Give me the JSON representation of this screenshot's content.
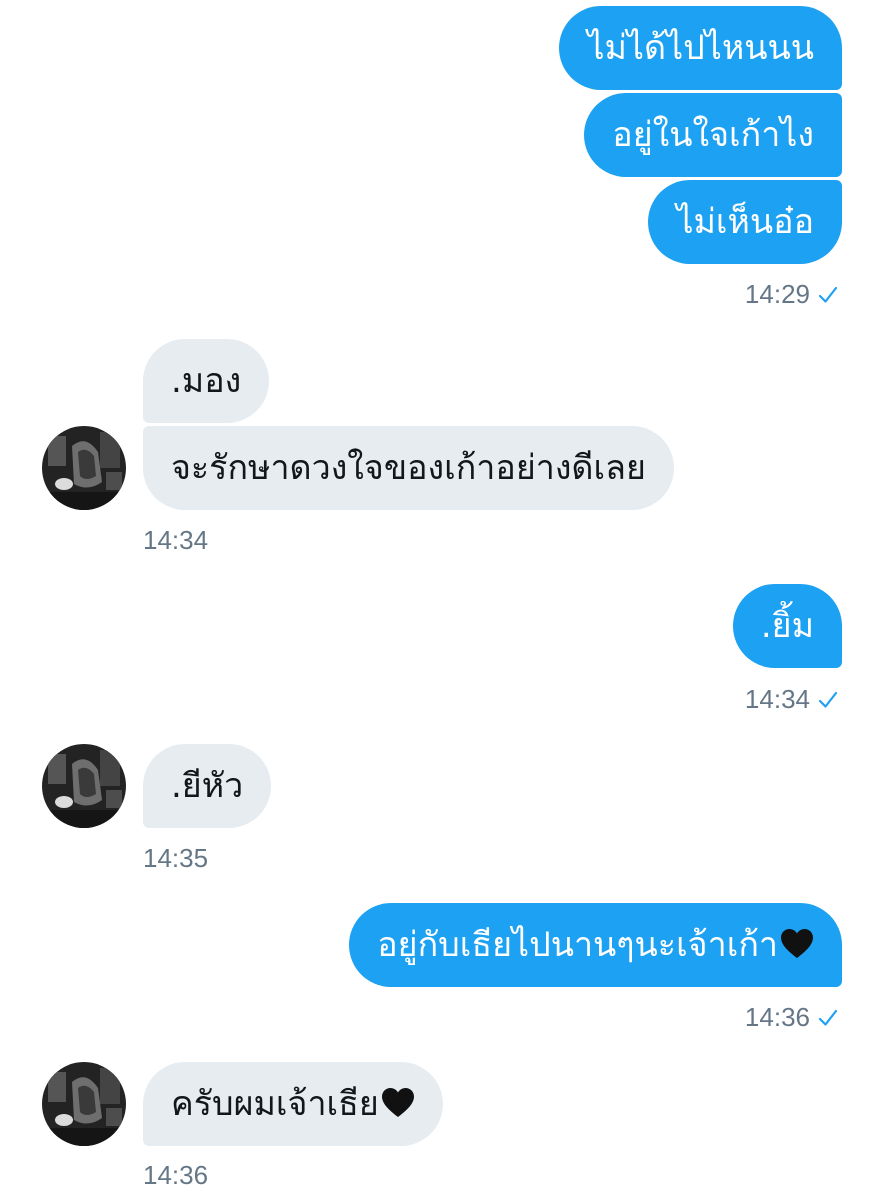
{
  "conversation": {
    "messages": [
      {
        "side": "out",
        "text": "ไม่ได้ไปไหนนน"
      },
      {
        "side": "out",
        "text": "อยู่ในใจเก้าไง"
      },
      {
        "side": "out",
        "text": "ไม่เห็นอ๋อ"
      },
      {
        "side": "in",
        "text": ".มอง"
      },
      {
        "side": "in",
        "text": "จะรักษาดวงใจของเก้าอย่างดีเลย"
      },
      {
        "side": "out",
        "text": ".ยิ้ม"
      },
      {
        "side": "in",
        "text": ".ยีหัว"
      },
      {
        "side": "out",
        "text": "อยู่กับเธียไปนานๆนะเจ้าเก้า",
        "emoji": "black-heart"
      },
      {
        "side": "in",
        "text": "ครับผมเจ้าเธีย",
        "emoji": "black-heart"
      }
    ],
    "timestamps": [
      "14:29",
      "14:34",
      "14:34",
      "14:35",
      "14:36",
      "14:36"
    ],
    "read_receipt_icon": "check-icon"
  },
  "colors": {
    "outgoing_bubble": "#1da1f2",
    "incoming_bubble": "#e6ecf0",
    "timestamp_text": "#657786",
    "checkmark": "#1da1f2"
  }
}
